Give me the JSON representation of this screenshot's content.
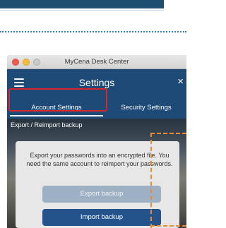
{
  "window": {
    "title": "MyCena Desk Center"
  },
  "header": {
    "title": "Settings",
    "menu_icon": "hamburger-menu-icon",
    "close_glyph": "×"
  },
  "tabs": [
    {
      "label": "Account Settings",
      "active": true
    },
    {
      "label": "Security Settings",
      "active": false
    }
  ],
  "section": {
    "label": "Export / Reimport backup"
  },
  "card": {
    "description": "Export your passwords into an encrypted file. You need the same account to reimport your passwords.",
    "export_button": "Export backup",
    "import_button": "Import backup"
  },
  "colors": {
    "header_blue": "#1e4a78",
    "highlight_red": "#d9262c",
    "annotation_orange": "#f08a2e",
    "import_button": "#24528a",
    "export_button_disabled": "#9eb0c3"
  }
}
